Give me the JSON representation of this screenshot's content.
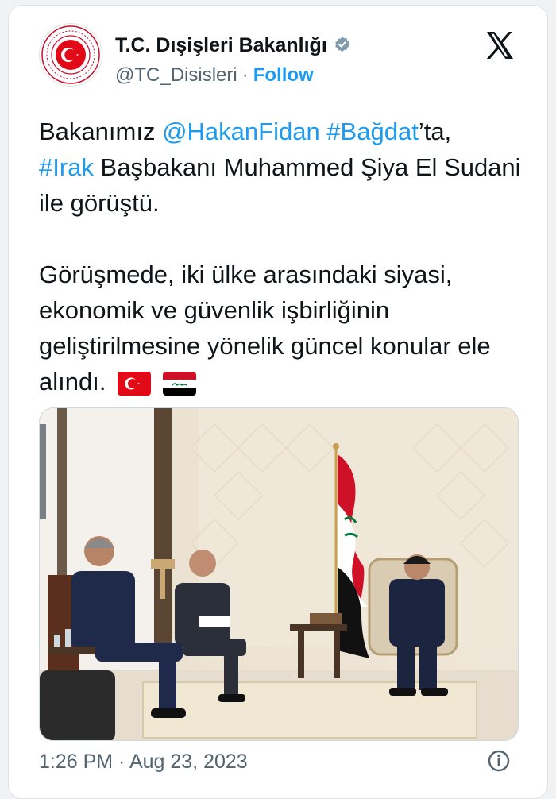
{
  "account": {
    "display_name": "T.C. Dışişleri Bakanlığı",
    "handle": "@TC_Disisleri",
    "separator": "·",
    "follow_label": "Follow",
    "avatar_icon": "turkish-mfa-seal-icon",
    "verified_icon": "verified-badge-icon"
  },
  "brand": {
    "logo_icon": "x-logo-icon"
  },
  "tweet": {
    "paragraph1": {
      "t1": "Bakanımız ",
      "mention": "@HakanFidan",
      "t2": " ",
      "hashtag1": "#Bağdat",
      "t3": "’ta, ",
      "hashtag2": "#Irak",
      "t4": " Başbakanı Muhammed Şiya El Sudani ile görüştü."
    },
    "paragraph2": {
      "text": "Görüşmede, iki ülke arasındaki siyasi, ekonomik ve güvenlik işbirliğinin geliştirilmesine yönelik güncel konular ele alındı.",
      "emoji": [
        "turkey-flag-icon",
        "iraq-flag-icon"
      ]
    }
  },
  "meta": {
    "timestamp": "1:26 PM · Aug 23, 2023",
    "info_icon": "info-icon"
  },
  "colors": {
    "accent": "#1d9bf0",
    "text": "#0f1419",
    "muted": "#536471",
    "turkey_red": "#e30a17",
    "iraq_red": "#ce1126",
    "iraq_green": "#007a3d"
  }
}
